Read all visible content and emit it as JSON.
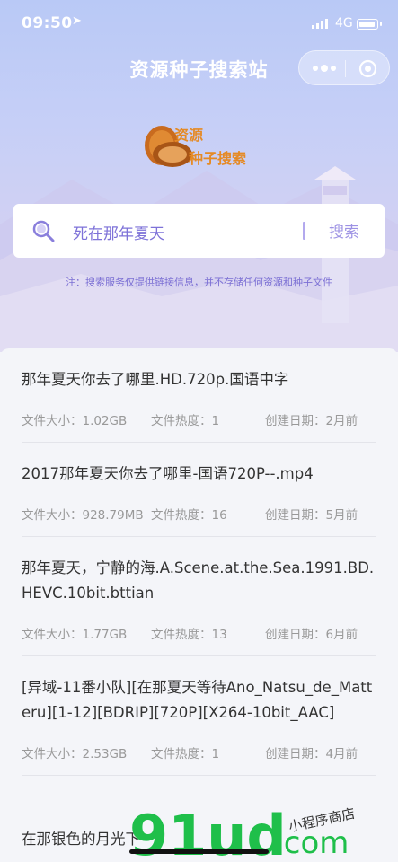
{
  "status": {
    "time": "09:50",
    "network": "4G"
  },
  "nav": {
    "title": "资源种子搜索站"
  },
  "logo": {
    "line1": "资源",
    "line2": "种子搜索"
  },
  "search": {
    "value": "死在那年夏天",
    "button": "搜索"
  },
  "notice": "注：搜索服务仅提供链接信息，并不存储任何资源和种子文件",
  "results": [
    {
      "title": "那年夏天你去了哪里.HD.720p.国语中字",
      "size": "文件大小：1.02GB",
      "heat": "文件热度：1",
      "date": "创建日期：2月前"
    },
    {
      "title": "2017那年夏天你去了哪里-国语720P--.mp4",
      "size": "文件大小：928.79MB",
      "heat": "文件热度：16",
      "date": "创建日期：5月前"
    },
    {
      "title": "那年夏天，宁静的海.A.Scene.at.the.Sea.1991.BD.HEVC.10bit.bttian",
      "size": "文件大小：1.77GB",
      "heat": "文件热度：13",
      "date": "创建日期：6月前"
    },
    {
      "title": "[异域-11番小队][在那夏天等待Ano_Natsu_de_Matteru][1-12][BDRIP][720P][X264-10bit_AAC]",
      "size": "文件大小：2.53GB",
      "heat": "文件热度：1",
      "date": "创建日期：4月前"
    }
  ],
  "last_title": "在那银色的月光下",
  "watermark": {
    "brand": "91ud",
    "tld": ".com",
    "tagline": "小程序商店"
  },
  "colors": {
    "accent": "#7b6fd4",
    "logo": "#e58a25"
  }
}
